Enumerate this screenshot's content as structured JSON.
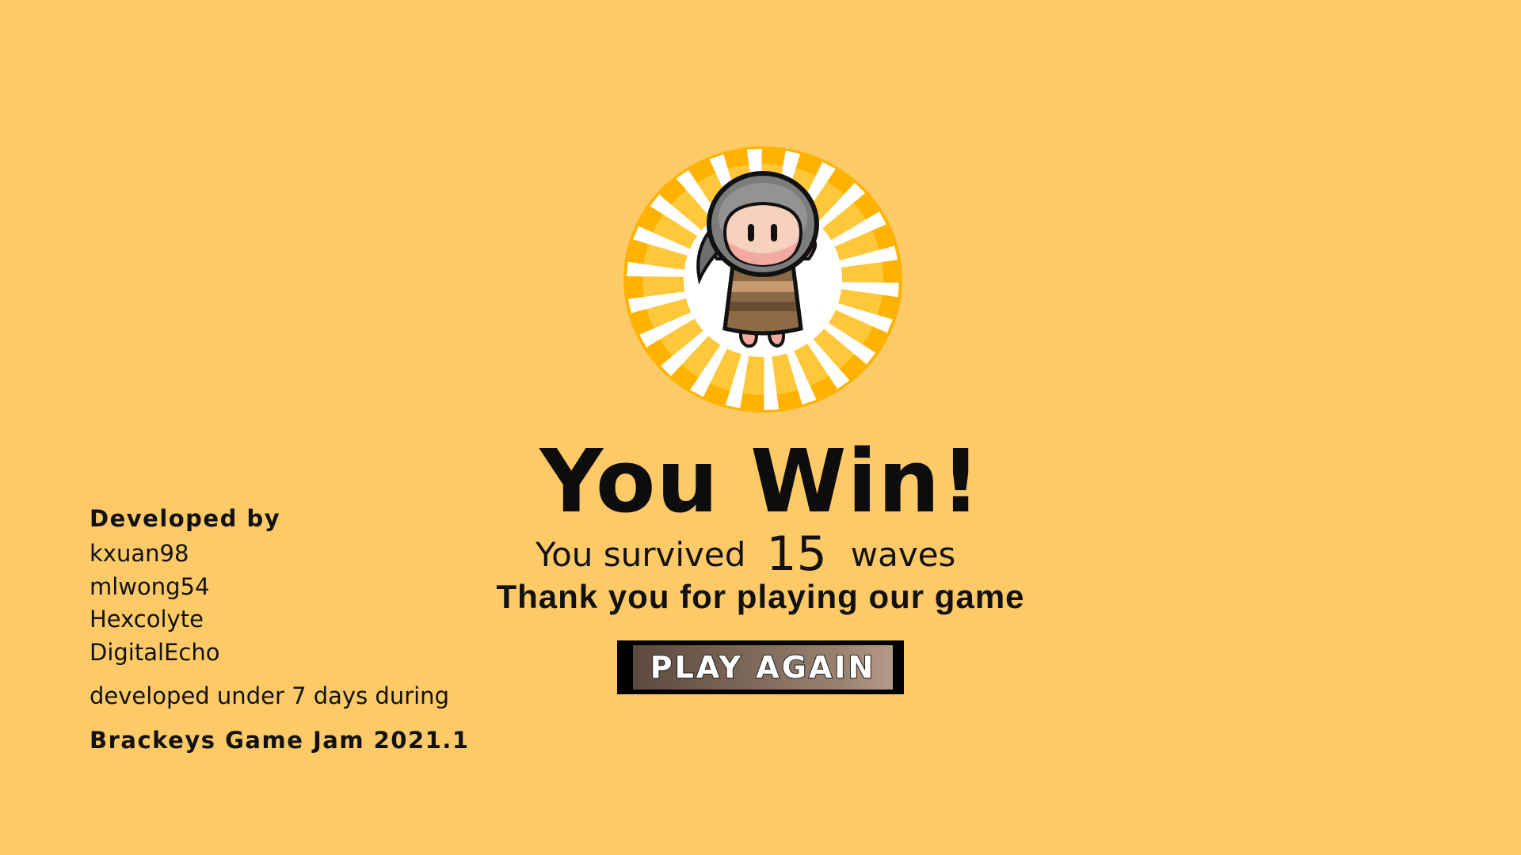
{
  "result": {
    "title": "You Win!",
    "survived_prefix": "You survived",
    "waves_count": "15",
    "survived_suffix": "waves",
    "thanks": "Thank you for playing our game"
  },
  "play_again_button": {
    "label": "PLAY AGAIN"
  },
  "credits": {
    "heading": "Developed by",
    "developers": [
      "kxuan98",
      "mlwong54",
      "Hexcolyte",
      "DigitalEcho"
    ],
    "note": "developed under 7 days during",
    "jam": "Brackeys Game Jam 2021.1"
  },
  "emblem": {
    "icon": "character-sunburst-icon",
    "colors": {
      "background": "#FECA68",
      "ring": "#FFB300",
      "ray": "#FFFFFF",
      "helmet": "#7C7C7C",
      "shirt": "#8B6A45"
    }
  }
}
